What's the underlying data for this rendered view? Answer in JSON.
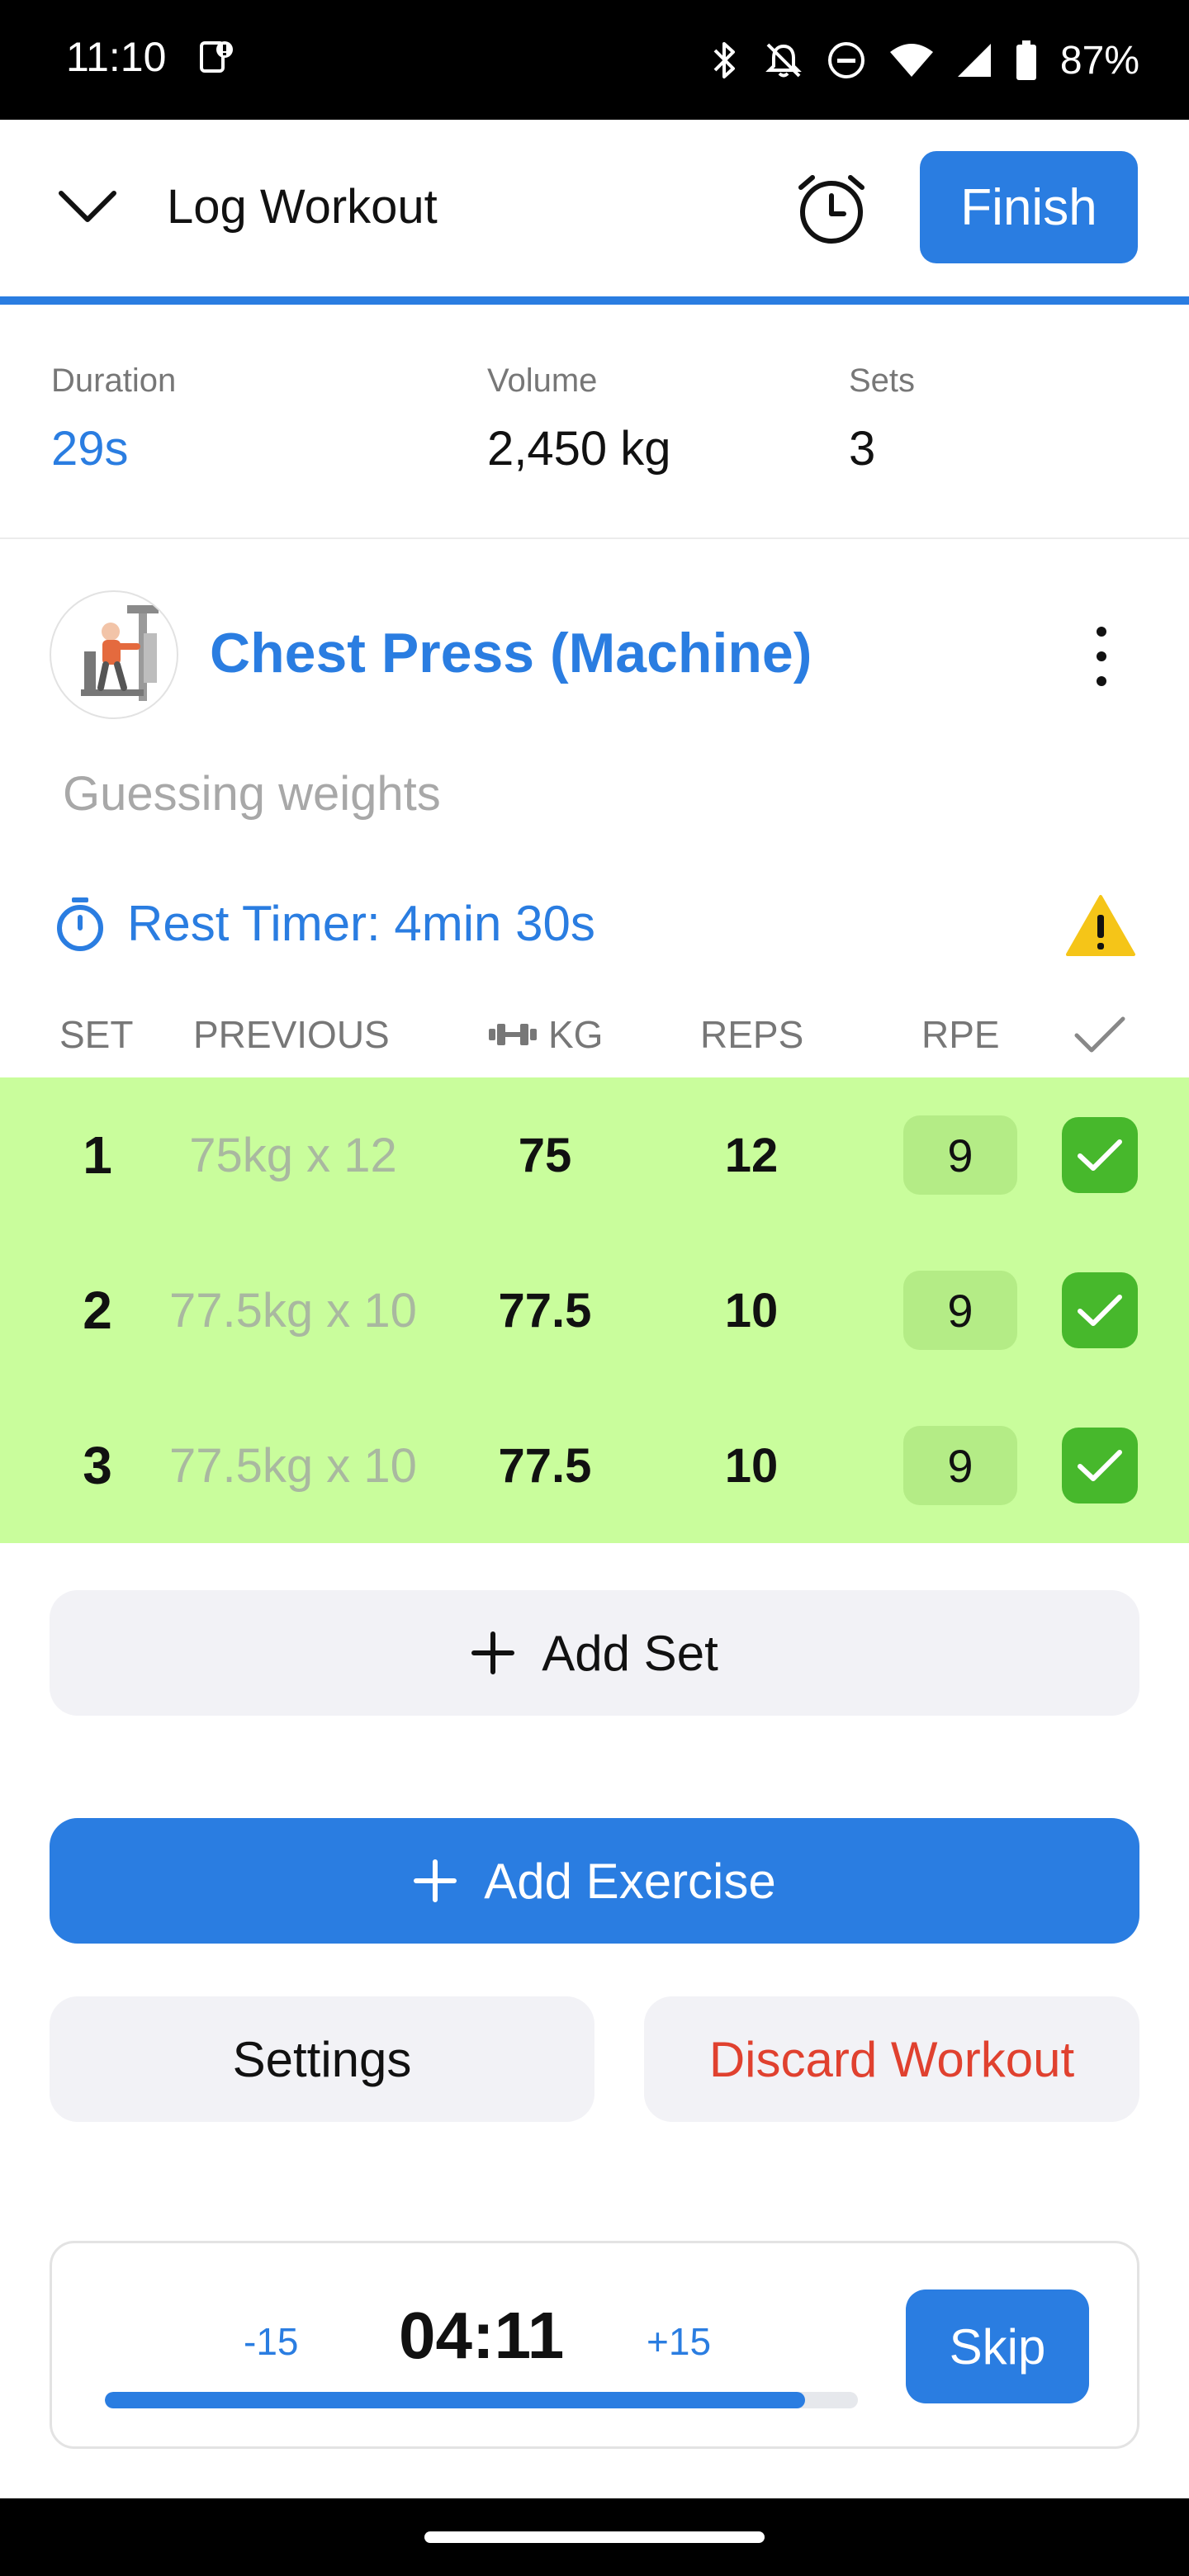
{
  "status_bar": {
    "time": "11:10",
    "battery": "87%"
  },
  "header": {
    "title": "Log Workout",
    "finish_label": "Finish"
  },
  "stats": [
    {
      "label": "Duration",
      "value": "29s"
    },
    {
      "label": "Volume",
      "value": "2,450 kg"
    },
    {
      "label": "Sets",
      "value": "3"
    }
  ],
  "exercise": {
    "name": "Chest Press (Machine)",
    "note_placeholder": "Guessing weights",
    "rest_timer": "Rest Timer: 4min 30s"
  },
  "table": {
    "headers": {
      "set": "SET",
      "previous": "PREVIOUS",
      "kg": "KG",
      "reps": "REPS",
      "rpe": "RPE"
    },
    "rows": [
      {
        "set": "1",
        "previous": "75kg x 12",
        "kg": "75",
        "reps": "12",
        "rpe": "9",
        "done": true
      },
      {
        "set": "2",
        "previous": "77.5kg x 10",
        "kg": "77.5",
        "reps": "10",
        "rpe": "9",
        "done": true
      },
      {
        "set": "3",
        "previous": "77.5kg x 10",
        "kg": "77.5",
        "reps": "10",
        "rpe": "9",
        "done": true
      }
    ]
  },
  "buttons": {
    "add_set": "Add Set",
    "add_exercise": "Add Exercise",
    "settings": "Settings",
    "discard": "Discard Workout"
  },
  "rest_timer_card": {
    "minus": "-15",
    "time": "04:11",
    "plus": "+15",
    "skip": "Skip",
    "progress": 0.93
  },
  "colors": {
    "accent": "#2a7de1",
    "completed_row": "#c9fd9c",
    "check": "#47b82c",
    "discard": "#e0412f",
    "warning": "#f5c518"
  }
}
